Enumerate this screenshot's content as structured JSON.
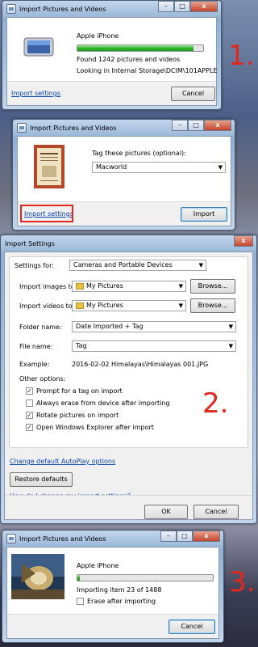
{
  "step1": {
    "title": "Import Pictures and Videos",
    "device_name": "Apple iPhone",
    "progress": 0.92,
    "found_text": "Found 1242 pictures and videos",
    "looking_text": "Looking in Internal Storage\\DCIM\\101APPLE",
    "import_settings_link": "Import settings",
    "cancel_label": "Cancel",
    "step_number": "1."
  },
  "step2_tag": {
    "title": "Import Pictures and Videos",
    "tag_label": "Tag these pictures (optional):",
    "tag_value": "Macworld",
    "import_settings_link": "Import settings",
    "import_label": "Import",
    "highlight_color": "#e4271d"
  },
  "settings": {
    "title": "Import Settings",
    "settings_for_label": "Settings for:",
    "settings_for_value": "Cameras and Portable Devices",
    "import_images_label": "Import images to:",
    "import_images_value": "My Pictures",
    "import_videos_label": "Import videos to:",
    "import_videos_value": "My Pictures",
    "browse_label": "Browse...",
    "folder_name_label": "Folder name:",
    "folder_name_value": "Date Imported + Tag",
    "file_name_label": "File name:",
    "file_name_value": "Tag",
    "example_label": "Example:",
    "example_value": "2016-02-02 Himalayas\\Himalayas 001.JPG",
    "other_options_label": "Other options:",
    "options": [
      {
        "label": "Prompt for a tag on import",
        "checked": true
      },
      {
        "label": "Always erase from device after importing",
        "checked": false
      },
      {
        "label": "Rotate pictures on import",
        "checked": true
      },
      {
        "label": "Open Windows Explorer after import",
        "checked": true
      }
    ],
    "autoplay_link": "Change default AutoPlay options",
    "restore_label": "Restore defaults",
    "help_link": "How do I change my import settings?",
    "ok_label": "OK",
    "cancel_label": "Cancel",
    "step_number": "2."
  },
  "step3": {
    "title": "Import Pictures and Videos",
    "device_name": "Apple iPhone",
    "progress": 0.02,
    "importing_text": "Importing item 23 of 1488",
    "erase_label": "Erase after importing",
    "cancel_label": "Cancel",
    "step_number": "3."
  }
}
